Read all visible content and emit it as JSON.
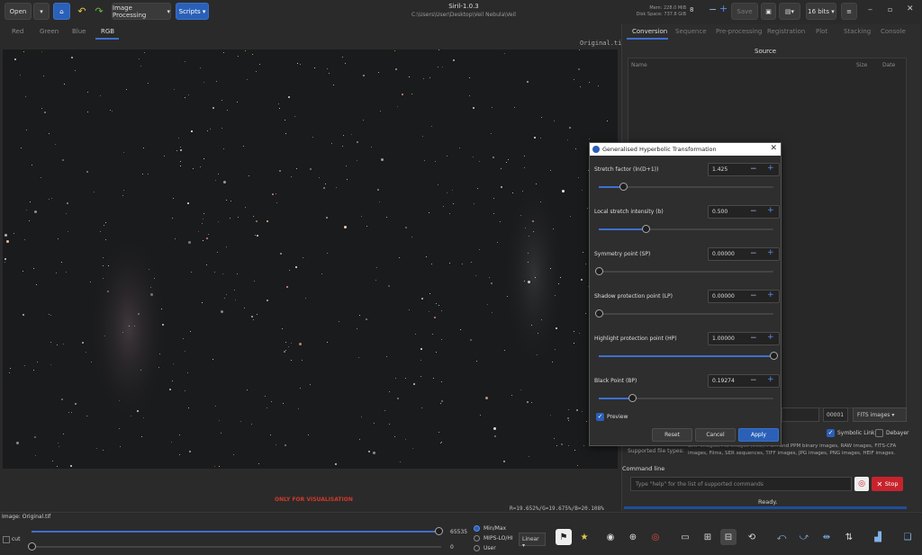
{
  "toolbar": {
    "open": "Open",
    "image_processing": "Image Processing",
    "scripts": "Scripts",
    "save": "Save",
    "bits": "16 bits"
  },
  "window": {
    "title": "Siril-1.0.3",
    "path": "C:\\Users\\User\\Desktop\\Veil Nebula\\Veil"
  },
  "memory": {
    "mem": "Mem: 228.0 MiB",
    "disk": "Disk Space: 737.8 GiB",
    "threads": "8"
  },
  "view_tabs": [
    "Red",
    "Green",
    "Blue",
    "RGB"
  ],
  "right_tabs": [
    "Conversion",
    "Sequence",
    "Pre-processing",
    "Registration",
    "Plot",
    "Stacking",
    "Console"
  ],
  "source": {
    "header": "Source",
    "col_name": "Name",
    "col_size": "Size",
    "col_date": "Date"
  },
  "canvas": {
    "filename": "Original.tif",
    "notice": "ONLY FOR VISUALISATION",
    "rgb_readout": "R=19.652%/G=19.675%/B=20.108%"
  },
  "dialog": {
    "title": "Generalised Hyperbolic Transformation",
    "params": [
      {
        "label": "Stretch factor (ln(D+1))",
        "value": "1.425",
        "slider": 0.14
      },
      {
        "label": "Local stretch intensity (b)",
        "value": "0.500",
        "slider": 0.27
      },
      {
        "label": "Symmetry point (SP)",
        "value": "0.00000",
        "slider": 0.0
      },
      {
        "label": "Shadow protection point (LP)",
        "value": "0.00000",
        "slider": 0.0
      },
      {
        "label": "Highlight protection point (HP)",
        "value": "1.00000",
        "slider": 1.0
      },
      {
        "label": "Black Point (BP)",
        "value": "0.19274",
        "slider": 0.19
      }
    ],
    "preview": "Preview",
    "reset": "Reset",
    "cancel": "Cancel",
    "apply": "Apply"
  },
  "conversion": {
    "index": "00001",
    "format": "FITS images",
    "symbolic": "Symbolic Link",
    "debayer": "Debayer",
    "supported_label": "Supported file types:",
    "supported_text": "BMP images, PIC images (IRIS), PGM and PPM binary images, RAW images, FITS-CFA images, Films, SER sequences, TIFF images, JPG images, PNG images, HEIF images."
  },
  "command": {
    "label": "Command line",
    "placeholder": "Type \"help\" for the list of supported commands",
    "stop": "Stop",
    "status": "Ready."
  },
  "bottom": {
    "image_label": "Image:",
    "image_name": "Original.tif",
    "cut": "cut",
    "hi": "65535",
    "lo": "0",
    "minmax": "Min/Max",
    "mipso": "MIPS-LO/HI",
    "user": "User",
    "scale": "Linear"
  },
  "colors": {
    "accent": "#2a60b8",
    "stop": "#c8232c",
    "notice": "#d23a2a"
  }
}
